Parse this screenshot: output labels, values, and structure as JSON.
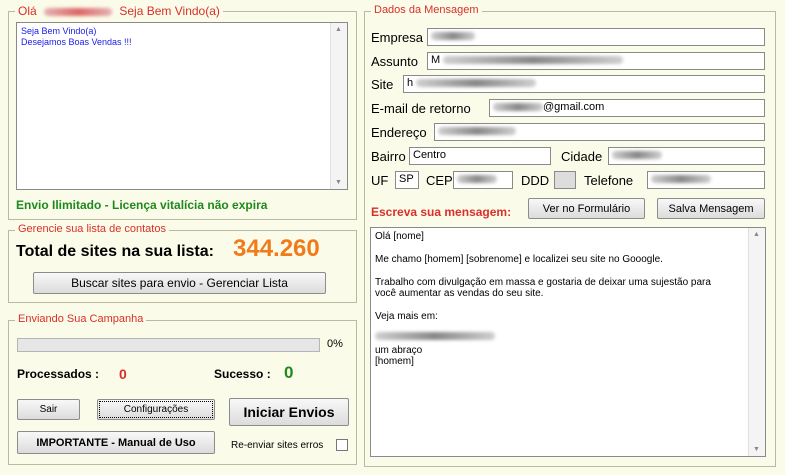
{
  "welcome": {
    "legend_prefix": "Olá",
    "legend_suffix": "Seja Bem Vindo(a)",
    "log_lines": [
      "Seja Bem Vindo(a)",
      "Desejamos Boas Vendas !!!"
    ],
    "license_text": "Envio Ilimitado - Licença vitalícia não expira"
  },
  "contacts": {
    "legend": "Gerencie sua lista de contatos",
    "total_label": "Total de sites na sua lista:",
    "total_value": "344.260",
    "manage_button": "Buscar sites para envio - Gerenciar Lista"
  },
  "campaign": {
    "legend": "Enviando Sua Campanha",
    "progress_percent": 0,
    "progress_label": "0%",
    "processed_label": "Processados :",
    "processed_value": "0",
    "success_label": "Sucesso :",
    "success_value": "0",
    "exit_button": "Sair",
    "config_button": "Configurações",
    "start_button": "Iniciar Envios",
    "manual_button": "IMPORTANTE -  Manual de Uso",
    "resend_label": "Re-enviar sites erros",
    "resend_checked": false
  },
  "message": {
    "legend": "Dados da Mensagem",
    "company_label": "Empresa",
    "subject_label": "Assunto",
    "subject_value": "M",
    "site_label": "Site",
    "site_value": "h",
    "email_label": "E-mail de retorno",
    "email_value": "@gmail.com",
    "address_label": "Endereço",
    "district_label": "Bairro",
    "district_value": "Centro",
    "city_label": "Cidade",
    "uf_label": "UF",
    "uf_value": "SP",
    "cep_label": "CEP",
    "ddd_label": "DDD",
    "phone_label": "Telefone",
    "write_label": "Escreva sua mensagem:",
    "preview_button": "Ver no Formulário",
    "save_button": "Salva Mensagem",
    "body_lines": [
      "Olá [nome]",
      "",
      "Me chamo [homem] [sobrenome] e localizei seu site no Gooogle.",
      "",
      "Trabalho com divulgação em massa e gostaria de deixar uma sujestão para",
      "você aumentar as vendas do seu site.",
      "",
      "Veja mais em:",
      "",
      "",
      "um abraço",
      "[homem]"
    ]
  },
  "colors": {
    "accent_red": "#d8302a",
    "success_green": "#1d8a1d",
    "count_orange": "#f07b1a",
    "log_blue": "#1a1ae6"
  }
}
